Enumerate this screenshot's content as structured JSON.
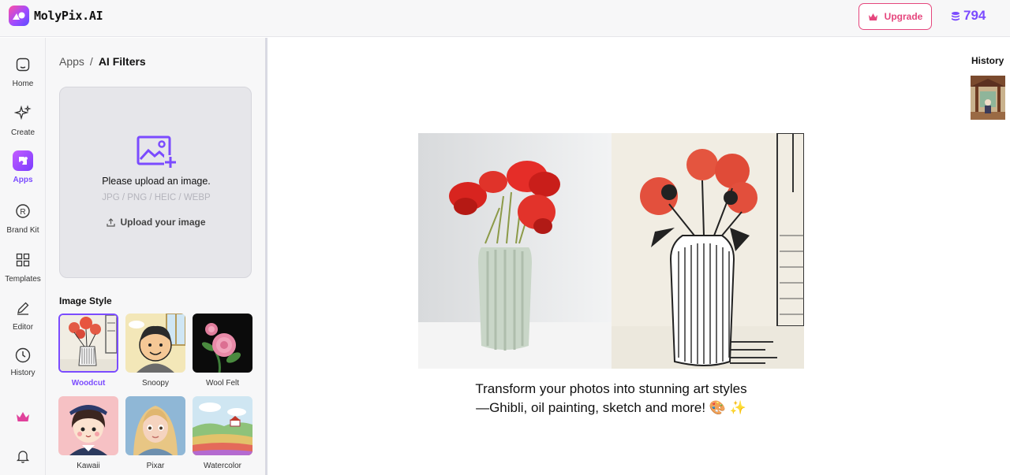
{
  "app": {
    "name": "MolyPix.AI"
  },
  "header": {
    "upgrade_label": "Upgrade",
    "credits": "794"
  },
  "rail": {
    "items": [
      {
        "label": "Home",
        "icon": "home-icon"
      },
      {
        "label": "Create",
        "icon": "sparkle-icon"
      },
      {
        "label": "Apps",
        "icon": "apps-icon"
      },
      {
        "label": "Brand Kit",
        "icon": "registered-icon"
      },
      {
        "label": "Templates",
        "icon": "grid-icon"
      },
      {
        "label": "Editor",
        "icon": "pencil-icon"
      },
      {
        "label": "History",
        "icon": "clock-icon"
      }
    ],
    "premium_icon": "crown-icon",
    "notifications_icon": "bell-icon"
  },
  "breadcrumb": {
    "root": "Apps",
    "separator": "/",
    "current": "AI Filters"
  },
  "upload": {
    "title": "Please upload an image.",
    "formats": "JPG / PNG / HEIC / WEBP",
    "button_label": "Upload your image"
  },
  "styles": {
    "title": "Image Style",
    "items": [
      {
        "label": "Woodcut",
        "selected": true
      },
      {
        "label": "Snoopy",
        "selected": false
      },
      {
        "label": "Wool Felt",
        "selected": false
      },
      {
        "label": "Kawaii",
        "selected": false
      },
      {
        "label": "Pixar",
        "selected": false
      },
      {
        "label": "Watercolor",
        "selected": false
      }
    ]
  },
  "history": {
    "title": "History"
  },
  "hero": {
    "caption": "Transform your photos into stunning art styles—Ghibli, oil painting, sketch and more! 🎨 ✨"
  },
  "colors": {
    "accent": "#7b4bff",
    "upgrade": "#e5467d",
    "panel_bg": "#f7f7f8"
  }
}
